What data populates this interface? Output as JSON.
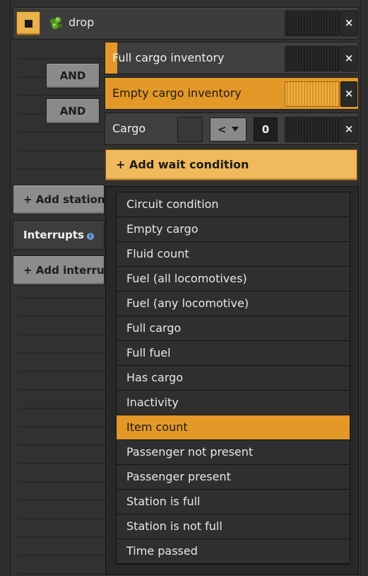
{
  "header": {
    "title": "drop",
    "icon": "green-ore-icon"
  },
  "and_buttons": [
    "AND",
    "AND"
  ],
  "conditions": [
    {
      "label": "Full cargo inventory"
    },
    {
      "label": "Empty cargo inventory"
    },
    {
      "label": "Cargo",
      "operator": "<",
      "value": "0"
    }
  ],
  "close_glyph": "×",
  "add_wait_label": "+ Add wait condition",
  "sidebar": {
    "add_station": "+ Add station",
    "interrupts": "Interrupts",
    "add_interrupt": "+ Add interrupt"
  },
  "dropdown": {
    "items": [
      "Circuit condition",
      "Empty cargo",
      "Fluid count",
      "Fuel (all locomotives)",
      "Fuel (any locomotive)",
      "Full cargo",
      "Full fuel",
      "Has cargo",
      "Inactivity",
      "Item count",
      "Passenger not present",
      "Passenger present",
      "Station is full",
      "Station is not full",
      "Time passed"
    ],
    "selected": "Item count"
  },
  "colors": {
    "accent": "#e39827",
    "accent_light": "#f0b95b"
  }
}
